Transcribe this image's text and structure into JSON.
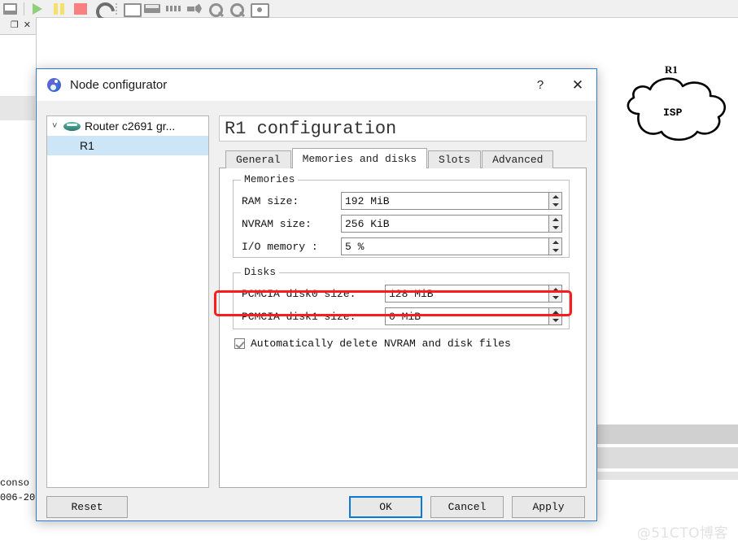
{
  "background": {
    "toolbar": {
      "icons": [
        "document-icon",
        "separator",
        "play-icon",
        "pause-icon",
        "stop-icon",
        "reload-icon",
        "dots-handle",
        "screenshot-icon",
        "console-icon",
        "dashes-icon",
        "link-icon",
        "zoom-in-icon",
        "zoom-out-icon",
        "camera-icon"
      ]
    },
    "left_panel": {
      "restore_label": "❐",
      "close_label": "✕"
    },
    "console_lines": [
      "conso",
      "006-20"
    ],
    "topology": {
      "node_label": "R1",
      "cloud_label": "ISP"
    },
    "watermark": "@51CTO博客"
  },
  "dialog": {
    "title": "Node configurator",
    "help_label": "?",
    "close_label": "✕",
    "tree": {
      "chevron": "˅",
      "group_label": "Router c2691 gr...",
      "child_label": "R1"
    },
    "pane_title": "R1 configuration",
    "tabs": [
      {
        "label": "General",
        "active": false
      },
      {
        "label": "Memories and disks",
        "active": true
      },
      {
        "label": "Slots",
        "active": false
      },
      {
        "label": "Advanced",
        "active": false
      }
    ],
    "memories": {
      "group_title": "Memories",
      "fields": [
        {
          "label": "RAM size:",
          "value": "192 MiB"
        },
        {
          "label": "NVRAM size:",
          "value": "256 KiB"
        },
        {
          "label": "I/O memory :",
          "value": "5 %"
        }
      ]
    },
    "disks": {
      "group_title": "Disks",
      "fields": [
        {
          "label": "PCMCIA disk0 size:",
          "value": "128 MiB",
          "highlighted": true
        },
        {
          "label": "PCMCIA disk1 size:",
          "value": "0 MiB",
          "highlighted": false
        }
      ]
    },
    "checkbox": {
      "label": "Automatically delete NVRAM and disk files",
      "checked": true
    },
    "buttons": {
      "reset": "Reset",
      "ok": "OK",
      "cancel": "Cancel",
      "apply": "Apply"
    },
    "annotation_color": "#fb1d1d"
  }
}
